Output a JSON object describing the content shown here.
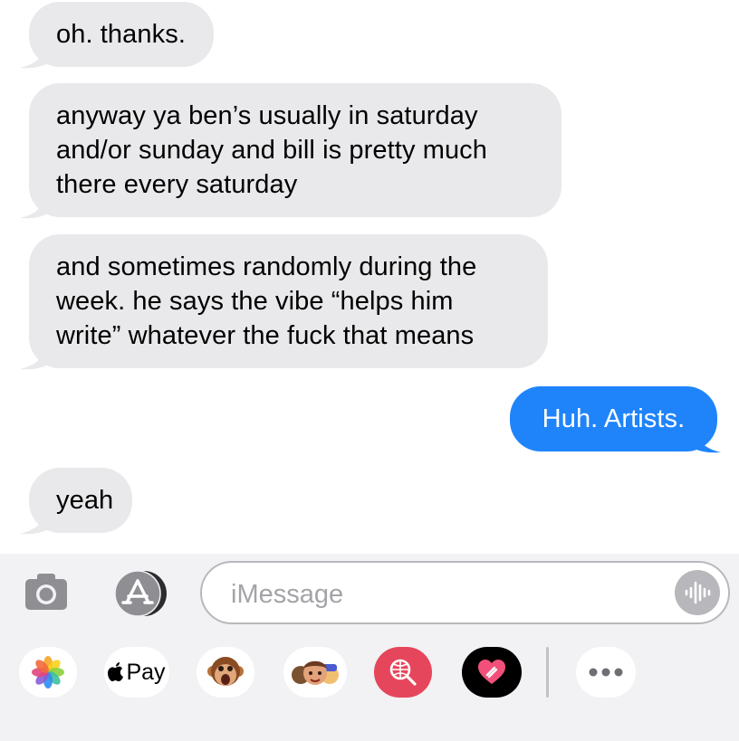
{
  "messages": [
    {
      "text": "oh. thanks.",
      "direction": "received"
    },
    {
      "text": "anyway ya ben’s usually in saturday\nand/or sunday and bill is pretty much\nthere every saturday",
      "direction": "received"
    },
    {
      "text": "and sometimes randomly during the\nweek. he says the vibe “helps him\nwrite” whatever the fuck that means",
      "direction": "received"
    },
    {
      "text": "Huh. Artists.",
      "direction": "sent"
    },
    {
      "text": "yeah",
      "direction": "received"
    }
  ],
  "compose": {
    "placeholder": "iMessage",
    "value": "",
    "camera_icon": "camera-icon",
    "appstore_icon": "app-store-icon",
    "audio_icon": "audio-waveform-icon"
  },
  "apps_drawer": {
    "apple_pay_label": "Pay",
    "items": [
      "photos-icon",
      "apple-pay-icon",
      "animoji-monkey-icon",
      "memoji-icon",
      "web-search-icon",
      "digital-touch-icon",
      "more-icon"
    ]
  },
  "colors": {
    "received_bubble": "#e9e9eb",
    "sent_bubble": "#1f84fa",
    "bar_background": "#f2f2f4"
  }
}
